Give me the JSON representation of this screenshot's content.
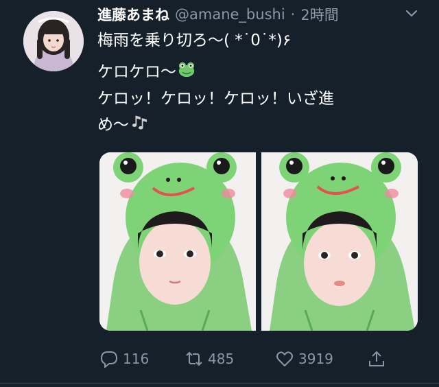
{
  "tweet": {
    "author_name": "進藤あまね",
    "author_handle": "@amane_bushi",
    "separator": "·",
    "time_ago": "2時間",
    "text_lines": [
      "梅雨を乗り切ろ〜( *˙0˙*)۶",
      "ケロケロ〜",
      "ケロッ！ケロッ！ケロッ！いざ進",
      "め〜"
    ],
    "emojis": [
      "frog-emoji",
      "musical-notes-emoji"
    ],
    "photos_count": 2
  },
  "actions": {
    "reply_count": "116",
    "retweet_count": "485",
    "like_count": "3919"
  },
  "colors": {
    "background": "#15202b",
    "secondary_text": "#8899a6",
    "frog_green": "#6ec96b"
  },
  "icons": [
    "chevron-down-icon",
    "reply-icon",
    "retweet-icon",
    "like-icon",
    "share-icon"
  ]
}
